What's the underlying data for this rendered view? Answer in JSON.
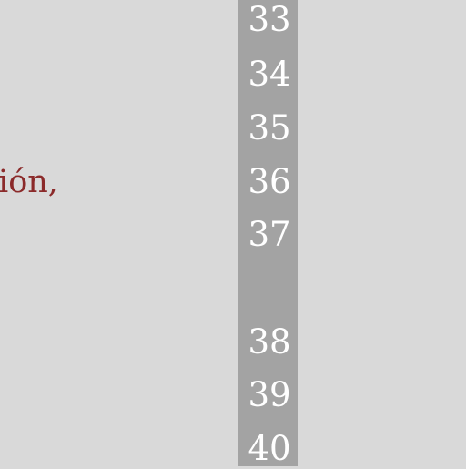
{
  "content": {
    "text_fragment": "ión,"
  },
  "line_numbers": [
    "33",
    "34",
    "35",
    "36",
    "37",
    "",
    "38",
    "39",
    "40"
  ],
  "colors": {
    "background": "#d9d9d9",
    "gutter": "#a3a3a3",
    "line_number_text": "#ffffff",
    "body_text": "#8b2a2a"
  }
}
